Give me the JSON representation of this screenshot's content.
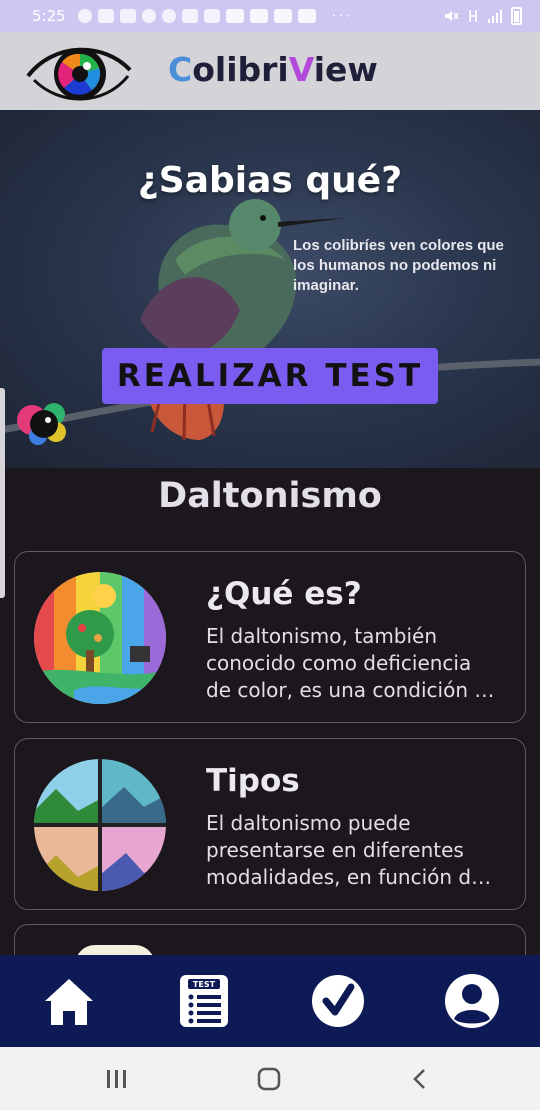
{
  "status_bar": {
    "time": "5:25",
    "more_dots": "···"
  },
  "header": {
    "brand_c": "C",
    "brand_part1": "olibri",
    "brand_v": "V",
    "brand_part2": "iew",
    "colors": {
      "brand_c": "#4a8dd9",
      "brand_v": "#b249d8",
      "header_bg": "#d3d3d8"
    }
  },
  "hero": {
    "title": "¿Sabias qué?",
    "text": "Los colibríes ven colores que los humanos no podemos ni imaginar.",
    "button_label": "REALIZAR TEST",
    "colors": {
      "button_bg": "#7a5cf0"
    }
  },
  "section": {
    "title": "Daltonismo"
  },
  "cards": [
    {
      "title": "¿Qué es?",
      "lines": [
        "El daltonismo, también",
        "conocido como deficiencia",
        "de color, es una condición …"
      ],
      "image_icon": "colorful-landscape-illustration"
    },
    {
      "title": "Tipos",
      "lines": [
        "El daltonismo puede",
        "presentarse en diferentes",
        "modalidades, en función d…"
      ],
      "image_icon": "color-variants-landscape-grid"
    }
  ],
  "bottom_nav": {
    "items": [
      {
        "icon": "home-icon"
      },
      {
        "icon": "test-list-icon",
        "badge": "TEST"
      },
      {
        "icon": "checkmark-icon"
      },
      {
        "icon": "profile-icon"
      }
    ],
    "colors": {
      "bg": "#0e1a55"
    }
  },
  "system_nav": {
    "items": [
      "recent-apps-icon",
      "home-circle-icon",
      "back-icon"
    ]
  }
}
